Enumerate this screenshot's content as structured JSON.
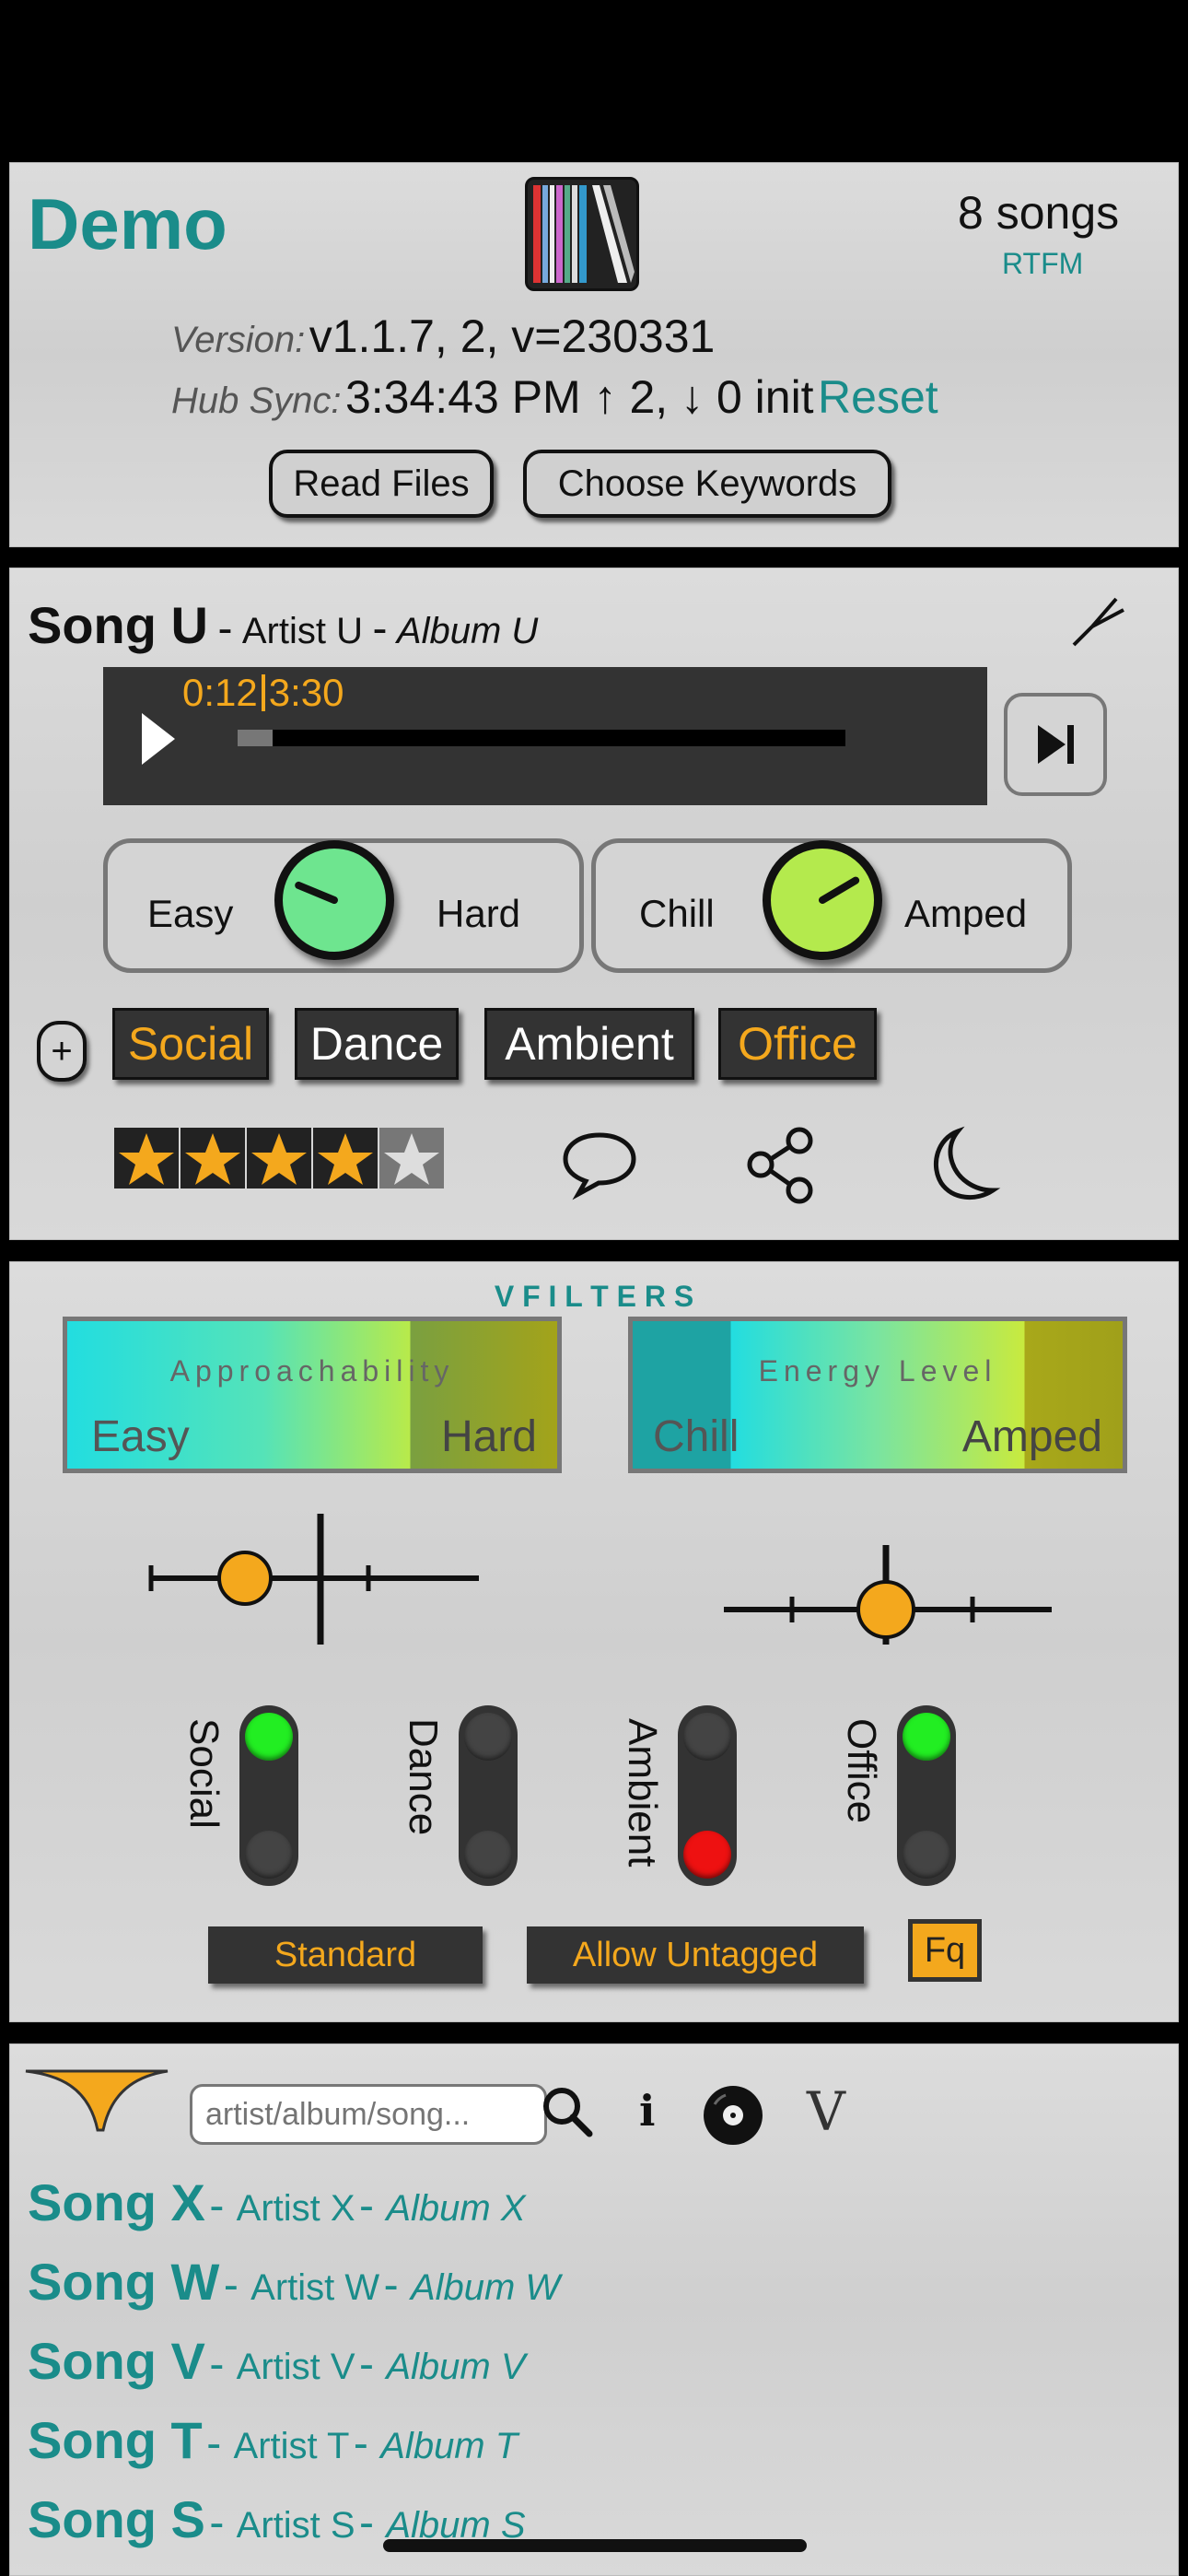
{
  "header": {
    "app_title": "Demo",
    "song_count": "8 songs",
    "help_link": "RTFM",
    "version_label": "Version:",
    "version_value": "v1.1.7, 2, v=230331",
    "hubsync_label": "Hub Sync:",
    "hubsync_value": "3:34:43 PM ↑ 2, ↓ 0 init",
    "reset_link": "Reset",
    "read_files_button": "Read Files",
    "choose_keywords_button": "Choose Keywords"
  },
  "now_playing": {
    "title": "Song U",
    "sep1": "-",
    "artist": "Artist U",
    "sep2": "-",
    "album": "Album U",
    "elapsed": "0:12",
    "duration": "3:30",
    "progress_fraction": 0.057,
    "knob1": {
      "left": "Easy",
      "right": "Hard",
      "value": 0.25,
      "color": "#6ee58f"
    },
    "knob2": {
      "left": "Chill",
      "right": "Amped",
      "value": 0.72,
      "color": "#b4ea4d"
    },
    "tags": [
      {
        "label": "Social",
        "active": true
      },
      {
        "label": "Dance",
        "active": false
      },
      {
        "label": "Ambient",
        "active": false
      },
      {
        "label": "Office",
        "active": true
      }
    ],
    "rating": 4,
    "rating_max": 5
  },
  "filters": {
    "heading": "V F I L T E R S",
    "approachability": {
      "title": "Approachability",
      "left": "Easy",
      "right": "Hard"
    },
    "energy": {
      "title": "Energy Level",
      "left": "Chill",
      "right": "Amped"
    },
    "keywords": [
      {
        "label": "Social",
        "state": "on"
      },
      {
        "label": "Dance",
        "state": "off"
      },
      {
        "label": "Ambient",
        "state": "exclude"
      },
      {
        "label": "Office",
        "state": "on"
      }
    ],
    "mode_button": "Standard",
    "untagged_button": "Allow Untagged",
    "fq_button": "Fq"
  },
  "library": {
    "search_placeholder": "artist/album/song...",
    "info_glyph": "i",
    "sort_glyph": "V",
    "songs": [
      {
        "title": "Song X",
        "artist": "Artist X",
        "album": "Album X"
      },
      {
        "title": "Song W",
        "artist": "Artist W",
        "album": "Album W"
      },
      {
        "title": "Song V",
        "artist": "Artist V",
        "album": "Album V"
      },
      {
        "title": "Song T",
        "artist": "Artist T",
        "album": "Album T"
      },
      {
        "title": "Song S",
        "artist": "Artist S",
        "album": "Album S"
      }
    ]
  },
  "colors": {
    "accent_teal": "#1a8c8a",
    "accent_orange": "#f4a81d",
    "toggle_on": "#22ee22",
    "toggle_exclude": "#ee1111"
  }
}
